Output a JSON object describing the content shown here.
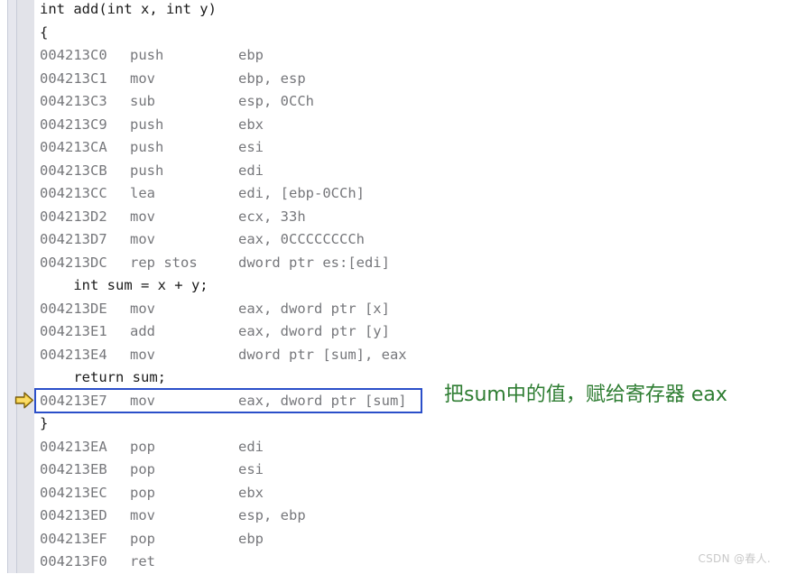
{
  "editor": {
    "name": "disassembly-view",
    "background": "#ffffff",
    "gutter_color": "#e2e3e9",
    "indicator_strip_color": "#e6e7ee",
    "asm_text_color": "#76777b",
    "source_text_color": "#1b1b1b"
  },
  "lines": [
    {
      "kind": "src",
      "text": "int add(int x, int y)"
    },
    {
      "kind": "src",
      "text": "{"
    },
    {
      "kind": "asm",
      "addr": "004213C0",
      "mnemonic": "push",
      "operands": "ebp"
    },
    {
      "kind": "asm",
      "addr": "004213C1",
      "mnemonic": "mov",
      "operands": "ebp, esp"
    },
    {
      "kind": "asm",
      "addr": "004213C3",
      "mnemonic": "sub",
      "operands": "esp, 0CCh"
    },
    {
      "kind": "asm",
      "addr": "004213C9",
      "mnemonic": "push",
      "operands": "ebx"
    },
    {
      "kind": "asm",
      "addr": "004213CA",
      "mnemonic": "push",
      "operands": "esi"
    },
    {
      "kind": "asm",
      "addr": "004213CB",
      "mnemonic": "push",
      "operands": "edi"
    },
    {
      "kind": "asm",
      "addr": "004213CC",
      "mnemonic": "lea",
      "operands": "edi, [ebp-0CCh]"
    },
    {
      "kind": "asm",
      "addr": "004213D2",
      "mnemonic": "mov",
      "operands": "ecx, 33h"
    },
    {
      "kind": "asm",
      "addr": "004213D7",
      "mnemonic": "mov",
      "operands": "eax, 0CCCCCCCCh"
    },
    {
      "kind": "asm",
      "addr": "004213DC",
      "mnemonic": "rep stos",
      "operands": "dword ptr es:[edi]"
    },
    {
      "kind": "src",
      "text": "    int sum = x + y;"
    },
    {
      "kind": "asm",
      "addr": "004213DE",
      "mnemonic": "mov",
      "operands": "eax, dword ptr [x]"
    },
    {
      "kind": "asm",
      "addr": "004213E1",
      "mnemonic": "add",
      "operands": "eax, dword ptr [y]"
    },
    {
      "kind": "asm",
      "addr": "004213E4",
      "mnemonic": "mov",
      "operands": "dword ptr [sum], eax"
    },
    {
      "kind": "src",
      "text": "    return sum;"
    },
    {
      "kind": "asm",
      "addr": "004213E7",
      "mnemonic": "mov",
      "operands": "eax, dword ptr [sum]",
      "current": true
    },
    {
      "kind": "src",
      "text": "}"
    },
    {
      "kind": "asm",
      "addr": "004213EA",
      "mnemonic": "pop",
      "operands": "edi"
    },
    {
      "kind": "asm",
      "addr": "004213EB",
      "mnemonic": "pop",
      "operands": "esi"
    },
    {
      "kind": "asm",
      "addr": "004213EC",
      "mnemonic": "pop",
      "operands": "ebx"
    },
    {
      "kind": "asm",
      "addr": "004213ED",
      "mnemonic": "mov",
      "operands": "esp, ebp"
    },
    {
      "kind": "asm",
      "addr": "004213EF",
      "mnemonic": "pop",
      "operands": "ebp"
    },
    {
      "kind": "asm",
      "addr": "004213F0",
      "mnemonic": "ret",
      "operands": ""
    }
  ],
  "current_instruction": {
    "addr": "004213E7",
    "highlight_border_color": "#2b4fc9",
    "pointer_icon": "execution-pointer-arrow-icon",
    "pointer_color": "#f5c518"
  },
  "annotation": {
    "text": "把sum中的值，赋给寄存器 eax",
    "color": "#2e7d32"
  },
  "watermark": {
    "text": "CSDN @春人."
  }
}
